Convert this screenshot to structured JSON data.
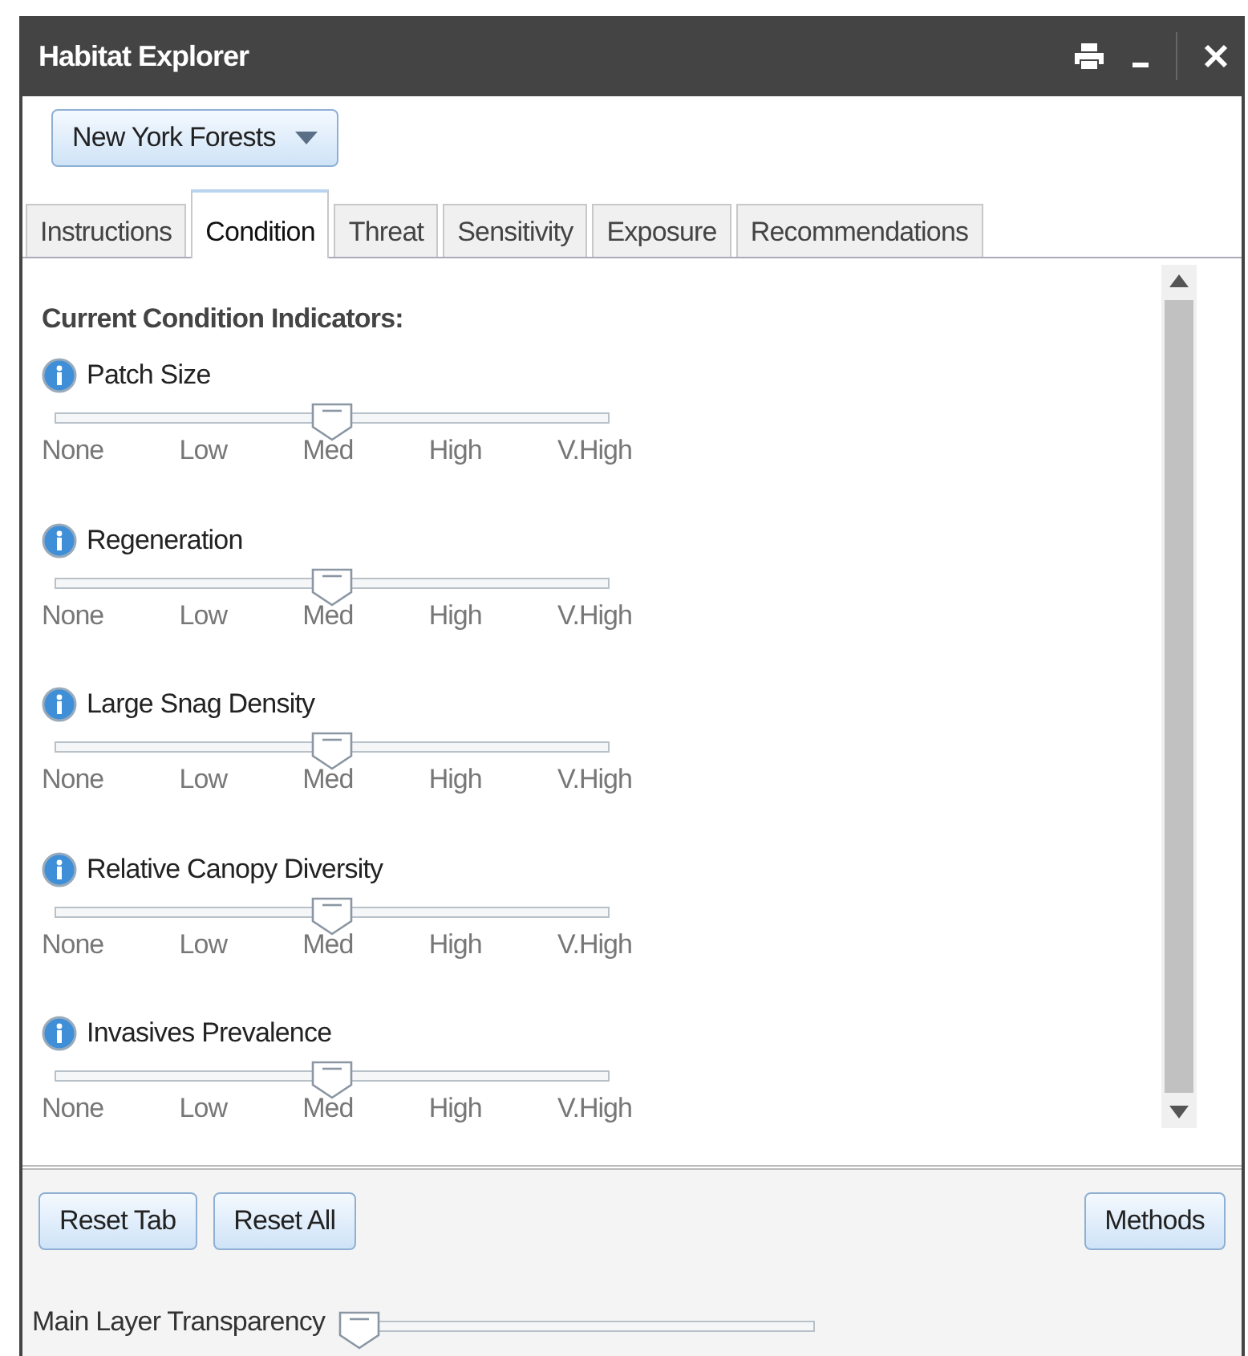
{
  "window": {
    "title": "Habitat Explorer"
  },
  "dropdown": {
    "value": "New York Forests"
  },
  "tabs": [
    {
      "label": "Instructions",
      "selected": false
    },
    {
      "label": "Condition",
      "selected": true
    },
    {
      "label": "Threat",
      "selected": false
    },
    {
      "label": "Sensitivity",
      "selected": false
    },
    {
      "label": "Exposure",
      "selected": false
    },
    {
      "label": "Recommendations",
      "selected": false
    }
  ],
  "section_title": "Current Condition Indicators:",
  "indicators": [
    {
      "name": "Patch Size",
      "level": 0.5,
      "ticks": [
        "None",
        "Low",
        "Med",
        "High",
        "V.High"
      ]
    },
    {
      "name": "Regeneration",
      "level": 0.5,
      "ticks": [
        "None",
        "Low",
        "Med",
        "High",
        "V.High"
      ]
    },
    {
      "name": "Large Snag Density",
      "level": 0.5,
      "ticks": [
        "None",
        "Low",
        "Med",
        "High",
        "V.High"
      ]
    },
    {
      "name": "Relative Canopy Diversity",
      "level": 0.5,
      "ticks": [
        "None",
        "Low",
        "Med",
        "High",
        "V.High"
      ]
    },
    {
      "name": "Invasives Prevalence",
      "level": 0.5,
      "ticks": [
        "None",
        "Low",
        "Med",
        "High",
        "V.High"
      ]
    }
  ],
  "buttons": [
    "Reset Tab",
    "Reset All"
  ],
  "methods_button": "Methods",
  "transparency": {
    "label": "Main Layer Transparency",
    "level": 0
  }
}
